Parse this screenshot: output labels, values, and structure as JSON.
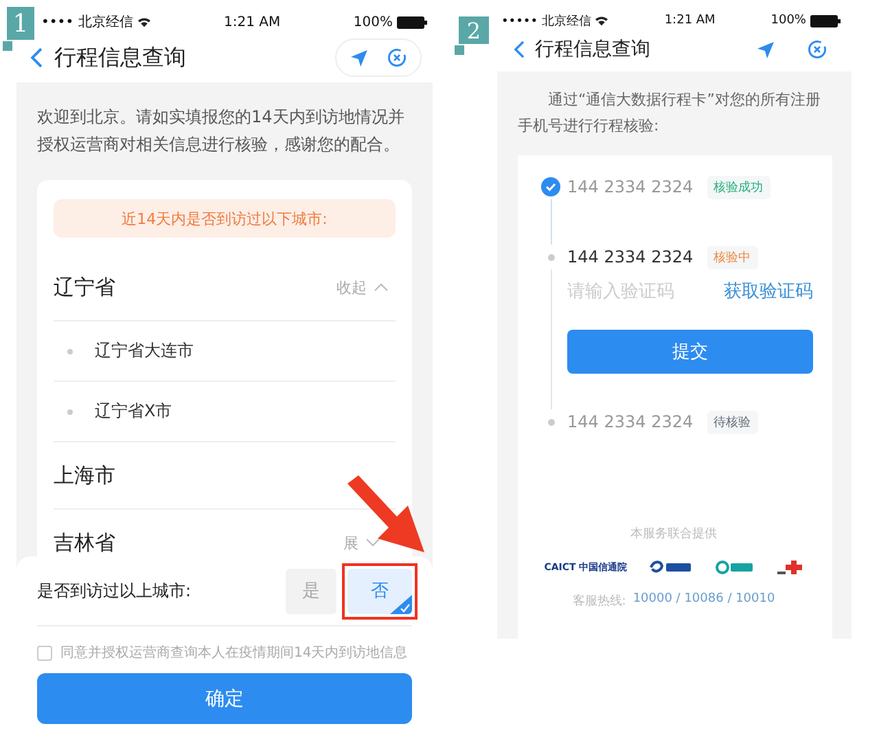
{
  "screen_1": {
    "badge": "1",
    "status_bar": {
      "carrier": "•••• 北京经信",
      "time": "1:21 AM",
      "battery": "100%"
    },
    "title": "行程信息查询",
    "intro": "欢迎到北京。请如实填报您的14天内到访地情况并授权运营商对相关信息进行核验，感谢您的配合。",
    "banner": "近14天内是否到访过以下城市:",
    "groups": [
      {
        "name": "辽宁省",
        "toggle": "收起",
        "expanded": true,
        "children": [
          "辽宁省大连市",
          "辽宁省X市"
        ]
      },
      {
        "name": "上海市"
      },
      {
        "name": "吉林省",
        "toggle": "展",
        "expanded": false
      }
    ],
    "question": {
      "label": "是否到访过以上城市:",
      "options": [
        {
          "label": "是",
          "selected": false
        },
        {
          "label": "否",
          "selected": true
        }
      ]
    },
    "consent": {
      "text": "同意并授权运营商查询本人在疫情期间14天内到访地信息",
      "checked": false
    },
    "confirm_button": "确定"
  },
  "screen_2": {
    "badge": "2",
    "status_bar": {
      "carrier": "••••• 北京经信",
      "time": "1:21 AM",
      "battery": "100%"
    },
    "title": "行程信息查询",
    "intro": "通过“通信大数据行程卡”对您的所有注册手机号进行行程核验:",
    "checks": [
      {
        "kind": "done",
        "phone": "144 2334 2324",
        "tag": "核验成功",
        "color": "#22b07a"
      },
      {
        "kind": "active",
        "phone": "144 2334 2324",
        "tag": "核验中",
        "color": "#f0883a",
        "code_placeholder": "请输入验证码",
        "get_code": "获取验证码",
        "submit": "提交"
      },
      {
        "kind": "pending",
        "phone": "144 2334 2324",
        "tag": "待核验",
        "color": "#666c78"
      }
    ],
    "footer": {
      "provided_by": "本服务联合提供",
      "logos": [
        {
          "kind": "caict",
          "text": "CAICT 中国信通院"
        },
        {
          "kind": "swirl"
        },
        {
          "kind": "ring"
        },
        {
          "kind": "knot"
        }
      ],
      "hotline_label": "客服热线:",
      "hotline": "10000 / 10086 / 10010"
    }
  }
}
